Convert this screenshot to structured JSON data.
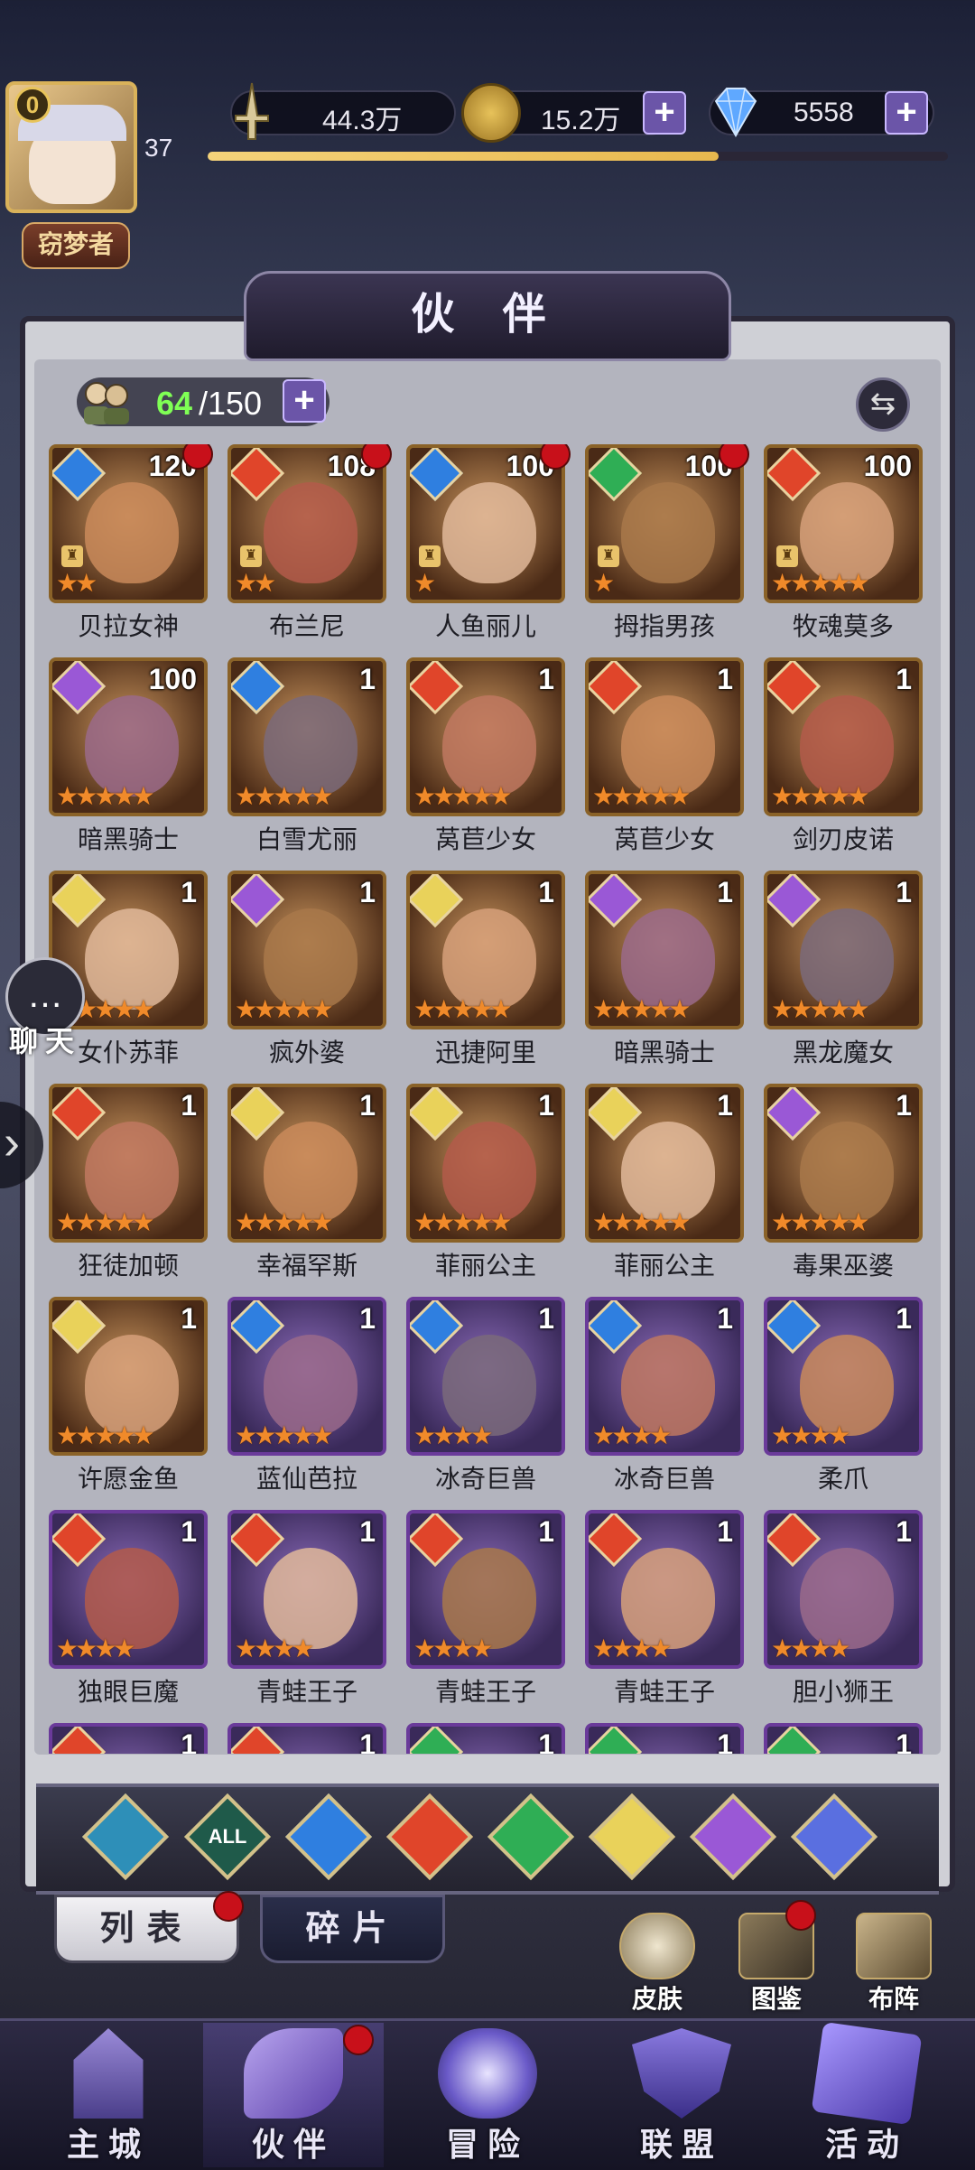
{
  "header": {
    "level": "37",
    "player_title": "窃梦者",
    "avatar_badge": "0",
    "power_value": "44.3万",
    "gold_value": "15.2万",
    "gem_value": "5558",
    "plus_symbol": "+"
  },
  "panel": {
    "title": "伙 伴",
    "count_current": "64",
    "count_max": "/150",
    "swap_icon": "⇆"
  },
  "heroes": [
    {
      "name": "贝拉女神",
      "level": "120",
      "element": "water",
      "stars": 2,
      "frame": "gold",
      "role": true,
      "red_dot": true
    },
    {
      "name": "布兰尼",
      "level": "108",
      "element": "fire",
      "stars": 2,
      "frame": "gold",
      "role": true,
      "red_dot": true
    },
    {
      "name": "人鱼丽儿",
      "level": "100",
      "element": "water",
      "stars": 1,
      "frame": "gold",
      "role": true,
      "red_dot": true
    },
    {
      "name": "拇指男孩",
      "level": "100",
      "element": "wind",
      "stars": 1,
      "frame": "gold",
      "role": true,
      "red_dot": true
    },
    {
      "name": "牧魂莫多",
      "level": "100",
      "element": "fire",
      "stars": 5,
      "frame": "gold",
      "role": true,
      "red_dot": false
    },
    {
      "name": "暗黑骑士",
      "level": "100",
      "element": "dark",
      "stars": 5,
      "frame": "gold",
      "role": false,
      "red_dot": false
    },
    {
      "name": "白雪尤丽",
      "level": "1",
      "element": "water",
      "stars": 5,
      "frame": "gold",
      "role": false,
      "red_dot": false
    },
    {
      "name": "莴苣少女",
      "level": "1",
      "element": "fire",
      "stars": 5,
      "frame": "gold",
      "role": false,
      "red_dot": false
    },
    {
      "name": "莴苣少女",
      "level": "1",
      "element": "fire",
      "stars": 5,
      "frame": "gold",
      "role": false,
      "red_dot": false
    },
    {
      "name": "剑刃皮诺",
      "level": "1",
      "element": "fire",
      "stars": 5,
      "frame": "gold",
      "role": false,
      "red_dot": false
    },
    {
      "name": "女仆苏菲",
      "level": "1",
      "element": "light",
      "stars": 5,
      "frame": "gold",
      "role": false,
      "red_dot": false
    },
    {
      "name": "疯外婆",
      "level": "1",
      "element": "dark",
      "stars": 5,
      "frame": "gold",
      "role": false,
      "red_dot": false
    },
    {
      "name": "迅捷阿里",
      "level": "1",
      "element": "light",
      "stars": 5,
      "frame": "gold",
      "role": false,
      "red_dot": false
    },
    {
      "name": "暗黑骑士",
      "level": "1",
      "element": "dark",
      "stars": 5,
      "frame": "gold",
      "role": false,
      "red_dot": false
    },
    {
      "name": "黑龙魔女",
      "level": "1",
      "element": "dark",
      "stars": 5,
      "frame": "gold",
      "role": false,
      "red_dot": false
    },
    {
      "name": "狂徒加顿",
      "level": "1",
      "element": "fire",
      "stars": 5,
      "frame": "gold",
      "role": false,
      "red_dot": false
    },
    {
      "name": "幸福罕斯",
      "level": "1",
      "element": "light",
      "stars": 5,
      "frame": "gold",
      "role": false,
      "red_dot": false
    },
    {
      "name": "菲丽公主",
      "level": "1",
      "element": "light",
      "stars": 5,
      "frame": "gold",
      "role": false,
      "red_dot": false
    },
    {
      "name": "菲丽公主",
      "level": "1",
      "element": "light",
      "stars": 5,
      "frame": "gold",
      "role": false,
      "red_dot": false
    },
    {
      "name": "毒果巫婆",
      "level": "1",
      "element": "dark",
      "stars": 5,
      "frame": "gold",
      "role": false,
      "red_dot": false
    },
    {
      "name": "许愿金鱼",
      "level": "1",
      "element": "light",
      "stars": 5,
      "frame": "gold",
      "role": false,
      "red_dot": false
    },
    {
      "name": "蓝仙芭拉",
      "level": "1",
      "element": "water",
      "stars": 5,
      "frame": "purple",
      "role": false,
      "red_dot": false
    },
    {
      "name": "冰奇巨兽",
      "level": "1",
      "element": "water",
      "stars": 4,
      "frame": "purple",
      "role": false,
      "red_dot": false
    },
    {
      "name": "冰奇巨兽",
      "level": "1",
      "element": "water",
      "stars": 4,
      "frame": "purple",
      "role": false,
      "red_dot": false
    },
    {
      "name": "柔爪",
      "level": "1",
      "element": "water",
      "stars": 4,
      "frame": "purple",
      "role": false,
      "red_dot": false
    },
    {
      "name": "独眼巨魔",
      "level": "1",
      "element": "fire",
      "stars": 4,
      "frame": "purple",
      "role": false,
      "red_dot": false
    },
    {
      "name": "青蛙王子",
      "level": "1",
      "element": "fire",
      "stars": 4,
      "frame": "purple",
      "role": false,
      "red_dot": false
    },
    {
      "name": "青蛙王子",
      "level": "1",
      "element": "fire",
      "stars": 4,
      "frame": "purple",
      "role": false,
      "red_dot": false
    },
    {
      "name": "青蛙王子",
      "level": "1",
      "element": "fire",
      "stars": 4,
      "frame": "purple",
      "role": false,
      "red_dot": false
    },
    {
      "name": "胆小狮王",
      "level": "1",
      "element": "fire",
      "stars": 4,
      "frame": "purple",
      "role": false,
      "red_dot": false
    },
    {
      "name": "",
      "level": "1",
      "element": "fire",
      "stars": 0,
      "frame": "purple",
      "role": false,
      "red_dot": false
    },
    {
      "name": "",
      "level": "1",
      "element": "fire",
      "stars": 0,
      "frame": "purple",
      "role": false,
      "red_dot": false
    },
    {
      "name": "",
      "level": "1",
      "element": "wind",
      "stars": 0,
      "frame": "purple",
      "role": false,
      "red_dot": false
    },
    {
      "name": "",
      "level": "1",
      "element": "wind",
      "stars": 0,
      "frame": "purple",
      "role": false,
      "red_dot": false
    },
    {
      "name": "",
      "level": "1",
      "element": "wind",
      "stars": 0,
      "frame": "purple",
      "role": false,
      "red_dot": false
    }
  ],
  "element_colors": {
    "water": "#2f7fe0",
    "fire": "#e0452a",
    "wind": "#2fae55",
    "light": "#e9d25a",
    "dark": "#9a58d6",
    "ether": "#5a6fe0",
    "base": "#2e8fb8"
  },
  "filters": [
    {
      "key": "base",
      "label": ""
    },
    {
      "key": "all",
      "label": "ALL"
    },
    {
      "key": "water",
      "label": ""
    },
    {
      "key": "fire",
      "label": ""
    },
    {
      "key": "wind",
      "label": ""
    },
    {
      "key": "light",
      "label": ""
    },
    {
      "key": "dark",
      "label": ""
    },
    {
      "key": "ether",
      "label": ""
    }
  ],
  "tabs": {
    "list": "列表",
    "fragments": "碎片"
  },
  "side_buttons": {
    "skin": "皮肤",
    "codex": "图鉴",
    "formation": "布阵"
  },
  "chat": {
    "label": "聊天",
    "icon": "…"
  },
  "nav": {
    "home": "主城",
    "partner": "伙伴",
    "adventure": "冒险",
    "alliance": "联盟",
    "events": "活动"
  }
}
